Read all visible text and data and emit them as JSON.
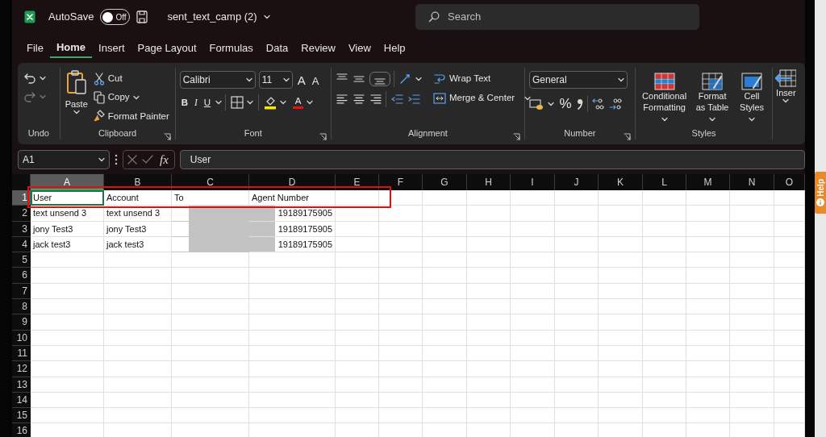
{
  "title_bar": {
    "autosave": {
      "label": "AutoSave",
      "on": false,
      "state_text": "Off"
    },
    "file_name": "sent_text_camp (2)",
    "search": {
      "placeholder": "Search"
    }
  },
  "tabs": [
    {
      "label": "File",
      "selected": false
    },
    {
      "label": "Home",
      "selected": true
    },
    {
      "label": "Insert",
      "selected": false
    },
    {
      "label": "Page Layout",
      "selected": false
    },
    {
      "label": "Formulas",
      "selected": false
    },
    {
      "label": "Data",
      "selected": false
    },
    {
      "label": "Review",
      "selected": false
    },
    {
      "label": "View",
      "selected": false
    },
    {
      "label": "Help",
      "selected": false
    }
  ],
  "ribbon": {
    "undo": {
      "label": "Undo",
      "redo_disabled": true
    },
    "clipboard": {
      "label": "Clipboard",
      "paste": "Paste",
      "cut": "Cut",
      "copy": "Copy",
      "format_painter": "Format Painter"
    },
    "font": {
      "label": "Font",
      "font_name": "Calibri",
      "font_size": "11",
      "grow": "A",
      "shrink": "A",
      "bold": "B",
      "italic": "I",
      "underline": "U",
      "font_color": "A"
    },
    "alignment": {
      "label": "Alignment",
      "wrap_text": "Wrap Text",
      "merge_center": "Merge & Center"
    },
    "number": {
      "label": "Number",
      "format": "General",
      "percent": "%"
    },
    "styles": {
      "label": "Styles",
      "conditional_formatting": "Conditional Formatting",
      "format_as_table": "Format as Table",
      "cell_styles": "Cell Styles"
    },
    "cells": {
      "insert": "Inser"
    }
  },
  "formula_bar": {
    "name_box": "A1",
    "function_label": "fx",
    "value": "User"
  },
  "sheet": {
    "columns": [
      {
        "label": "A",
        "selected": true
      },
      {
        "label": "B",
        "selected": false
      },
      {
        "label": "C",
        "selected": false
      },
      {
        "label": "D",
        "selected": false
      },
      {
        "label": "E",
        "selected": false
      },
      {
        "label": "F",
        "selected": false
      },
      {
        "label": "G",
        "selected": false
      },
      {
        "label": "H",
        "selected": false
      },
      {
        "label": "I",
        "selected": false
      },
      {
        "label": "J",
        "selected": false
      },
      {
        "label": "K",
        "selected": false
      },
      {
        "label": "L",
        "selected": false
      },
      {
        "label": "M",
        "selected": false
      },
      {
        "label": "N",
        "selected": false
      },
      {
        "label": "O",
        "selected": false
      }
    ],
    "rows": [
      {
        "number": "1",
        "selected": true,
        "cells": [
          {
            "text": "User",
            "kind": "text"
          },
          {
            "text": "Account",
            "kind": "text"
          },
          {
            "text": "To",
            "kind": "text"
          },
          {
            "text": "Agent Number",
            "kind": "text"
          }
        ]
      },
      {
        "number": "2",
        "selected": false,
        "cells": [
          {
            "text": "text unsend 3",
            "kind": "text"
          },
          {
            "text": "text unsend 3",
            "kind": "text"
          },
          {
            "kind": "redacted"
          },
          {
            "text": "19189175905",
            "kind": "number"
          }
        ]
      },
      {
        "number": "3",
        "selected": false,
        "cells": [
          {
            "text": "jony Test3",
            "kind": "text"
          },
          {
            "text": "jony Test3",
            "kind": "text"
          },
          {
            "kind": "redacted"
          },
          {
            "text": "19189175905",
            "kind": "number"
          }
        ]
      },
      {
        "number": "4",
        "selected": false,
        "cells": [
          {
            "text": "jack test3",
            "kind": "text"
          },
          {
            "text": "jack test3",
            "kind": "text"
          },
          {
            "kind": "redacted"
          },
          {
            "text": "19189175905",
            "kind": "number"
          }
        ]
      },
      {
        "number": "5",
        "selected": false
      },
      {
        "number": "6",
        "selected": false
      },
      {
        "number": "7",
        "selected": false
      },
      {
        "number": "8",
        "selected": false
      },
      {
        "number": "9",
        "selected": false
      },
      {
        "number": "10",
        "selected": false
      },
      {
        "number": "11",
        "selected": false
      },
      {
        "number": "12",
        "selected": false
      },
      {
        "number": "13",
        "selected": false
      },
      {
        "number": "14",
        "selected": false
      },
      {
        "number": "15",
        "selected": false
      },
      {
        "number": "16",
        "selected": false
      }
    ]
  },
  "help_tab": {
    "label": "Help"
  }
}
